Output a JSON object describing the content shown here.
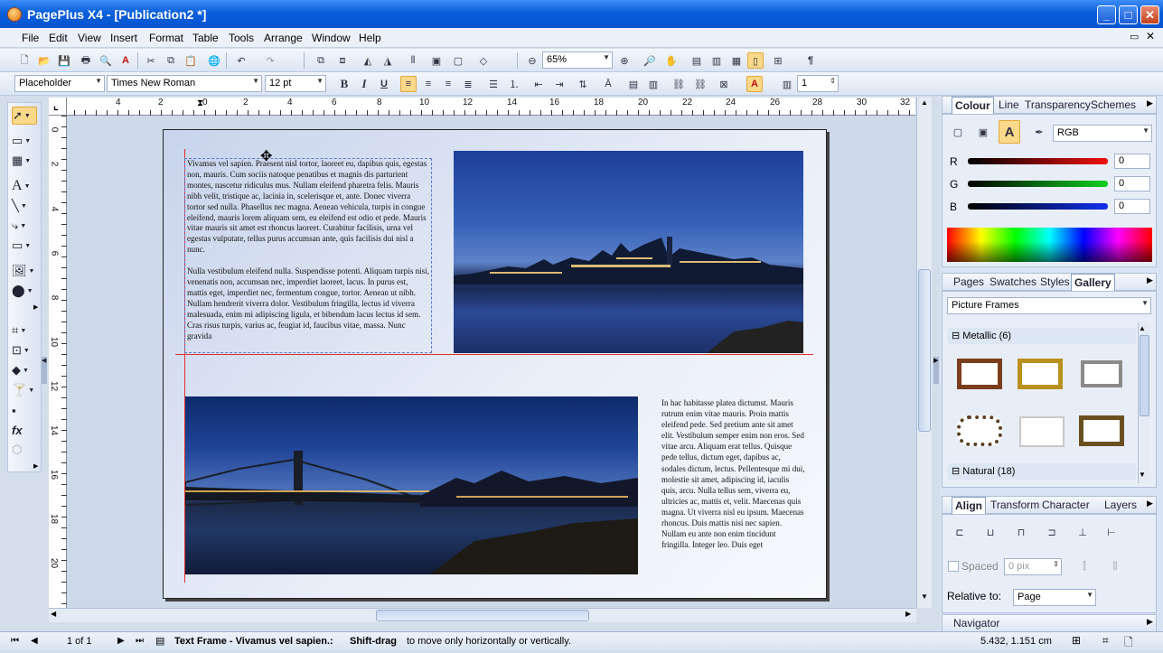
{
  "window": {
    "title": "PagePlus X4 - [Publication2 *]"
  },
  "menu": [
    "File",
    "Edit",
    "View",
    "Insert",
    "Format",
    "Table",
    "Tools",
    "Arrange",
    "Window",
    "Help"
  ],
  "toolbar": {
    "zoom": "65%"
  },
  "format_bar": {
    "style": "Placeholder",
    "font": "Times New Roman",
    "size": "12 pt",
    "columns": "1"
  },
  "ruler": {
    "h": [
      "4",
      "2",
      "0",
      "2",
      "4",
      "6",
      "8",
      "10",
      "12",
      "14",
      "16",
      "18",
      "20",
      "22",
      "24",
      "26",
      "28",
      "30",
      "32"
    ],
    "v": [
      "0",
      "2",
      "4",
      "6",
      "8",
      "10",
      "12",
      "14",
      "16",
      "18",
      "20"
    ]
  },
  "document": {
    "text1_p1": "Vivamus vel sapien. Praesent nisl tortor, laoreet eu, dapibus quis, egestas non, mauris. Cum sociis natoque penatibus et magnis dis parturient montes, nascetur ridiculus mus. Nullam eleifend pharetra felis. Mauris nibh velit, tristique ac, lacinia in, scelerisque et, ante. Donec viverra tortor sed nulla. Phasellus nec magna. Aenean vehicula, turpis in congue eleifend, mauris lorem aliquam sem, eu eleifend est odio et pede. Mauris vitae mauris sit amet est rhoncus laoreet. Curabitur facilisis, urna vel egestas vulputate, tellus purus accumsan ante, quis facilisis dui nisl a nunc.",
    "text1_p2": "Nulla vestibulum eleifend nulla. Suspendisse potenti. Aliquam turpis nisi, venenatis non, accumsan nec, imperdiet laoreet, lacus. In purus est, mattis eget, imperdiet nec, fermentum congue, tortor. Aenean ut nibh. Nullam hendrerit viverra dolor. Vestibulum fringilla, lectus id viverra malesuada, enim mi adipiscing ligula, et bibendum lacus lectus id sem. Cras risus turpis, varius ac, feugiat id, faucibus vitae, massa. Nunc gravida",
    "text2": "In hac habitasse platea dictumst. Mauris rutrum enim vitae mauris. Proin mattis eleifend pede. Sed pretium ante sit amet elit. Vestibulum semper enim non eros. Sed vitae arcu. Aliquam erat tellus. Quisque pede tellus, dictum eget, dapibus ac, sodales dictum, lectus. Pellentesque mi dui, molestie sit amet, adipiscing id, iaculis quis, arcu. Nulla tellus sem, viverra eu, ultricies ac, mattis et, velit. Maecenas quis magna. Ut viverra nisl eu ipsum. Maecenas rhoncus. Duis mattis nisi nec sapien. Nullam eu ante non enim tincidunt fringilla. Integer leo. Duis eget"
  },
  "colour_panel": {
    "tabs": [
      "Colour",
      "Line",
      "Transparency",
      "Schemes"
    ],
    "model": "RGB",
    "channels": [
      {
        "label": "R",
        "value": "0",
        "color": "#e01010"
      },
      {
        "label": "G",
        "value": "0",
        "color": "#10c020"
      },
      {
        "label": "B",
        "value": "0",
        "color": "#1030e0"
      }
    ]
  },
  "gallery_panel": {
    "tabs": [
      "Pages",
      "Swatches",
      "Styles",
      "Gallery"
    ],
    "category": "Picture Frames",
    "groups": [
      "Metallic (6)",
      "Natural (18)"
    ]
  },
  "align_panel": {
    "tabs": [
      "Align",
      "Transform",
      "Character",
      "Layers"
    ],
    "spaced_label": "Spaced",
    "spaced_value": "0 pix",
    "relative_label": "Relative to:",
    "relative_value": "Page"
  },
  "navigator": {
    "label": "Navigator"
  },
  "status": {
    "page": "1 of 1",
    "message_bold": "Text Frame - Vivamus vel sapien.:",
    "message_bold2": "Shift-drag",
    "message_rest": "to move only horizontally or vertically.",
    "coords": "5.432, 1.151 cm"
  }
}
